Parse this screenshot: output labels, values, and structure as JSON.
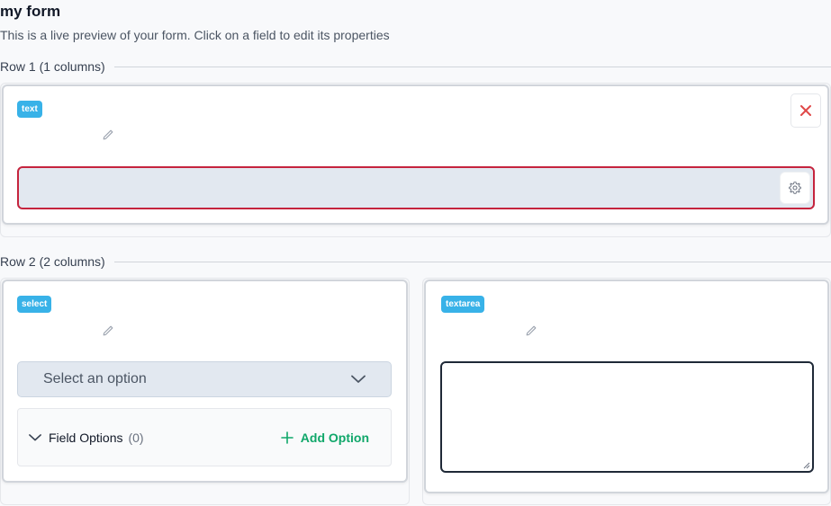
{
  "form": {
    "title": "my form",
    "subtitle": "This is a live preview of your form. Click on a field to edit its properties"
  },
  "rows": [
    {
      "label": "Row 1 (1 columns)",
      "fields": [
        {
          "type_badge": "text",
          "input_value": "",
          "icons": [
            "pencil-icon",
            "close-icon",
            "gear-icon"
          ]
        }
      ]
    },
    {
      "label": "Row 2 (2 columns)",
      "fields": [
        {
          "type_badge": "select",
          "select_value": "Select an option",
          "field_options_label": "Field Options",
          "field_options_count": "(0)",
          "add_option_label": "Add Option",
          "icons": [
            "pencil-icon",
            "chevron-down-icon",
            "plus-icon"
          ]
        },
        {
          "type_badge": "textarea",
          "textarea_value": "",
          "icons": [
            "pencil-icon",
            "resize-grip-icon"
          ]
        }
      ]
    }
  ],
  "colors": {
    "badge": "#38b2e8",
    "error_border": "#c5243e",
    "delete_icon": "#e04848",
    "add_option": "#10a76a"
  }
}
